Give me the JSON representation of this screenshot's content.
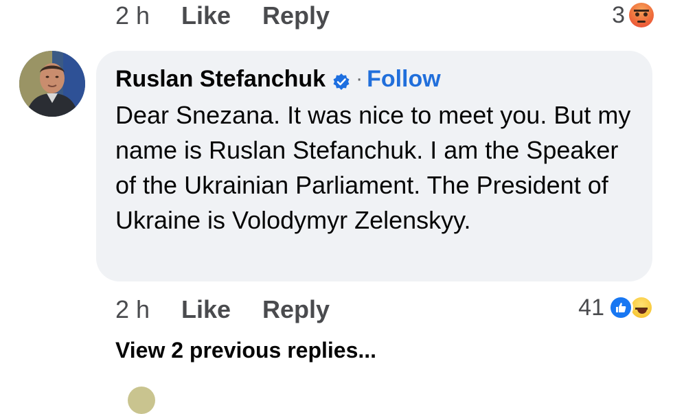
{
  "previous_comment": {
    "time": "2 h",
    "like_label": "Like",
    "reply_label": "Reply",
    "reaction_count": "3",
    "reactions": [
      "angry-icon"
    ]
  },
  "comment": {
    "author": "Ruslan Stefanchuk",
    "verified_icon": "verified-badge-icon",
    "separator": "·",
    "follow_label": "Follow",
    "text": "Dear Snezana. It was nice to meet you. But my name is Ruslan Stefanchuk. I am the Speaker of the Ukrainian Parliament. The President of Ukraine is Volodymyr Zelenskyy.",
    "time": "2 h",
    "like_label": "Like",
    "reply_label": "Reply",
    "reaction_count": "41",
    "reactions": [
      "like-icon",
      "haha-icon"
    ]
  },
  "replies": {
    "view_previous_label": "View 2 previous replies..."
  },
  "colors": {
    "bubble_bg": "#f0f2f5",
    "follow_blue": "#216fdb",
    "meta_gray": "#4a4b4e",
    "like_blue": "#1877f2"
  }
}
